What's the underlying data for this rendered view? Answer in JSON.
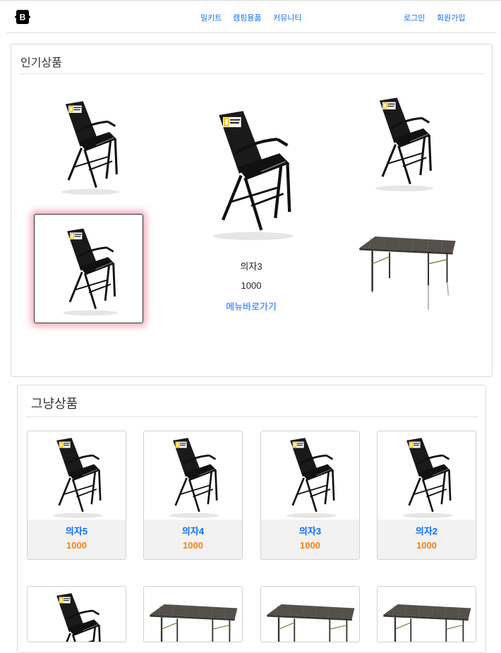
{
  "navbar": {
    "brand_icon": "bootstrap-icon",
    "brand_letter": "B",
    "links": [
      "밀키트",
      "캠핑용품",
      "커뮤니티"
    ],
    "auth": [
      "로그인",
      "회원가입"
    ]
  },
  "popular": {
    "title": "인기상품",
    "active_item": {
      "name": "의자3",
      "price": "1000",
      "link_label": "메뉴바로가기"
    }
  },
  "regular": {
    "title": "그냥상품",
    "row1": [
      {
        "name": "의자5",
        "price": "1000"
      },
      {
        "name": "의자4",
        "price": "1000"
      },
      {
        "name": "의자3",
        "price": "1000"
      },
      {
        "name": "의자2",
        "price": "1000"
      }
    ]
  },
  "colors": {
    "link": "#0d6efd",
    "price": "#fd7e14",
    "highlight": "#f05a78"
  }
}
